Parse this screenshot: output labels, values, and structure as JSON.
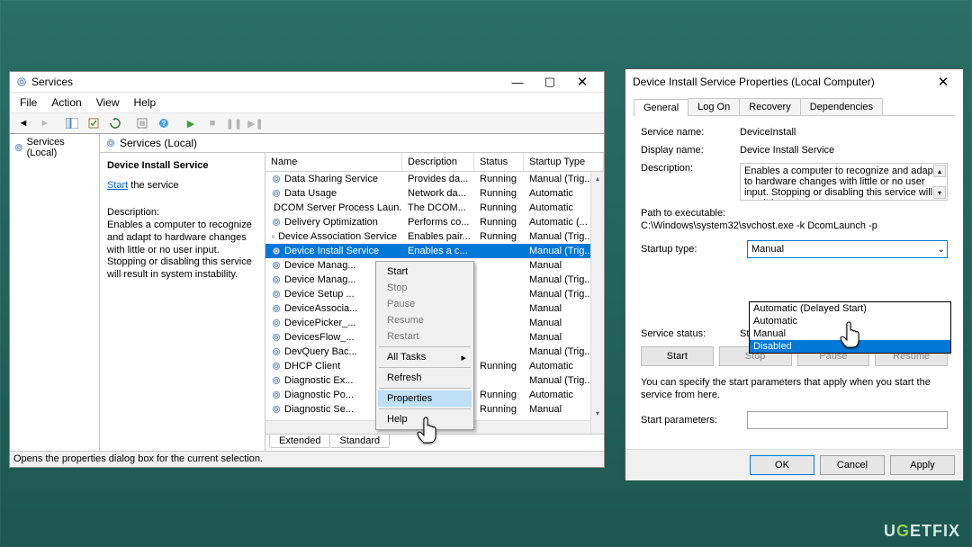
{
  "services_window": {
    "title": "Services",
    "menubar": [
      "File",
      "Action",
      "View",
      "Help"
    ],
    "left_pane_item": "Services (Local)",
    "pane_header": "Services (Local)",
    "info": {
      "selected_name": "Device Install Service",
      "start_link": "Start",
      "start_suffix": " the service",
      "desc_heading": "Description:",
      "desc_text": "Enables a computer to recognize and adapt to hardware changes with little or no user input. Stopping or disabling this service will result in system instability."
    },
    "columns": [
      "Name",
      "Description",
      "Status",
      "Startup Type"
    ],
    "rows": [
      {
        "name": "Data Sharing Service",
        "desc": "Provides da...",
        "status": "Running",
        "type": "Manual (Trig..."
      },
      {
        "name": "Data Usage",
        "desc": "Network da...",
        "status": "Running",
        "type": "Automatic"
      },
      {
        "name": "DCOM Server Process Laun...",
        "desc": "The DCOM...",
        "status": "Running",
        "type": "Automatic"
      },
      {
        "name": "Delivery Optimization",
        "desc": "Performs co...",
        "status": "Running",
        "type": "Automatic (..."
      },
      {
        "name": "Device Association Service",
        "desc": "Enables pair...",
        "status": "Running",
        "type": "Manual (Trig..."
      },
      {
        "name": "Device Install Service",
        "desc": "Enables a c...",
        "status": "",
        "type": "Manual (Trig...",
        "selected": true
      },
      {
        "name": "Device Manag...",
        "desc": "",
        "status": "",
        "type": "Manual"
      },
      {
        "name": "Device Manag...",
        "desc": "",
        "status": "",
        "type": "Manual (Trig..."
      },
      {
        "name": "Device Setup ...",
        "desc": "",
        "status": "",
        "type": "Manual (Trig..."
      },
      {
        "name": "DeviceAssocia...",
        "desc": "",
        "status": "",
        "type": "Manual"
      },
      {
        "name": "DevicePicker_...",
        "desc": "",
        "status": "",
        "type": "Manual"
      },
      {
        "name": "DevicesFlow_...",
        "desc": "",
        "status": "",
        "type": "Manual"
      },
      {
        "name": "DevQuery Bac...",
        "desc": "",
        "status": "",
        "type": "Manual (Trig..."
      },
      {
        "name": "DHCP Client",
        "desc": "",
        "status": "Running",
        "type": "Automatic"
      },
      {
        "name": "Diagnostic Ex...",
        "desc": "",
        "status": "",
        "type": "Manual (Trig..."
      },
      {
        "name": "Diagnostic Po...",
        "desc": "",
        "status": "Running",
        "type": "Automatic"
      },
      {
        "name": "Diagnostic Se...",
        "desc": "",
        "status": "Running",
        "type": "Manual"
      }
    ],
    "tabs": [
      "Extended",
      "Standard"
    ],
    "statusbar": "Opens the properties dialog box for the current selection."
  },
  "context_menu": {
    "items": [
      {
        "label": "Start",
        "enabled": true
      },
      {
        "label": "Stop",
        "enabled": false
      },
      {
        "label": "Pause",
        "enabled": false
      },
      {
        "label": "Resume",
        "enabled": false
      },
      {
        "label": "Restart",
        "enabled": false
      },
      {
        "sep": true
      },
      {
        "label": "All Tasks",
        "enabled": true,
        "submenu": true
      },
      {
        "sep": true
      },
      {
        "label": "Refresh",
        "enabled": true
      },
      {
        "sep": true
      },
      {
        "label": "Properties",
        "enabled": true,
        "highlight": true
      },
      {
        "sep": true
      },
      {
        "label": "Help",
        "enabled": true
      }
    ]
  },
  "props": {
    "title": "Device Install Service Properties (Local Computer)",
    "tabs": [
      "General",
      "Log On",
      "Recovery",
      "Dependencies"
    ],
    "fields": {
      "service_name_lbl": "Service name:",
      "service_name": "DeviceInstall",
      "display_name_lbl": "Display name:",
      "display_name": "Device Install Service",
      "description_lbl": "Description:",
      "description": "Enables a computer to recognize and adapt to hardware changes with little or no user input. Stopping or disabling this service will result in system",
      "path_lbl": "Path to executable:",
      "path": "C:\\Windows\\system32\\svchost.exe -k DcomLaunch -p",
      "startup_lbl": "Startup type:",
      "startup_value": "Manual",
      "startup_options": [
        "Automatic (Delayed Start)",
        "Automatic",
        "Manual",
        "Disabled"
      ],
      "startup_selected": "Disabled",
      "status_lbl": "Service status:",
      "status": "Stopped",
      "hint": "You can specify the start parameters that apply when you start the service from here.",
      "params_lbl": "Start parameters:"
    },
    "action_buttons": [
      "Start",
      "Stop",
      "Pause",
      "Resume"
    ],
    "dialog_buttons": [
      "OK",
      "Cancel",
      "Apply"
    ]
  },
  "watermark": "UGETFIX"
}
